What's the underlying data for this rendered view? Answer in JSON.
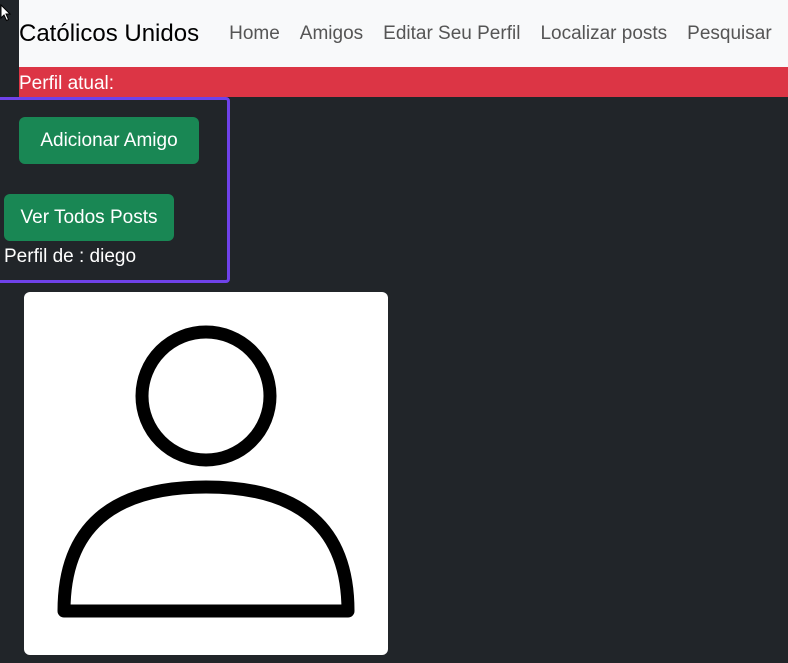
{
  "navbar": {
    "brand": "Católicos Unidos",
    "links": [
      "Home",
      "Amigos",
      "Editar Seu Perfil",
      "Localizar posts",
      "Pesquisar"
    ]
  },
  "alert": {
    "text": "Perfil atual:"
  },
  "actions": {
    "add_friend": "Adicionar Amigo",
    "view_posts": "Ver Todos Posts"
  },
  "profile": {
    "label": "Perfil de : diego"
  },
  "colors": {
    "background": "#212529",
    "navbar": "#f8f9fa",
    "alert": "#dc3545",
    "button": "#198754",
    "highlight": "#6f42e9"
  },
  "icons": {
    "cursor": "mouse-cursor-icon",
    "avatar": "user-avatar-icon"
  }
}
